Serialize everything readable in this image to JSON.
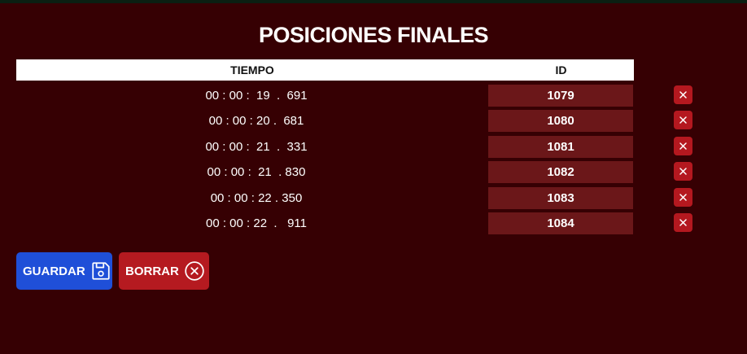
{
  "title": "POSICIONES FINALES",
  "table": {
    "headers": {
      "time": "TIEMPO",
      "id": "ID"
    },
    "rows": [
      {
        "time": "00 : 00 :  19  .  691",
        "id": "1079"
      },
      {
        "time": "00 : 00 : 20 .  681",
        "id": "1080"
      },
      {
        "time": "00 : 00 :  21  .  331",
        "id": "1081"
      },
      {
        "time": "00 : 00 :  21  . 830",
        "id": "1082"
      },
      {
        "time": "00 : 00 : 22 . 350",
        "id": "1083"
      },
      {
        "time": "00 : 00 : 22  .   911",
        "id": "1084"
      }
    ],
    "delete_icon": "close-icon"
  },
  "actions": {
    "save_label": "GUARDAR",
    "save_icon": "floppy-disk-icon",
    "clear_label": "BORRAR",
    "clear_icon": "circle-x-icon"
  },
  "colors": {
    "background": "#360003",
    "id_cell": "#6b1719",
    "delete_button": "#b4181f",
    "save_button": "#1f4fd8",
    "clear_button": "#b51a20"
  }
}
